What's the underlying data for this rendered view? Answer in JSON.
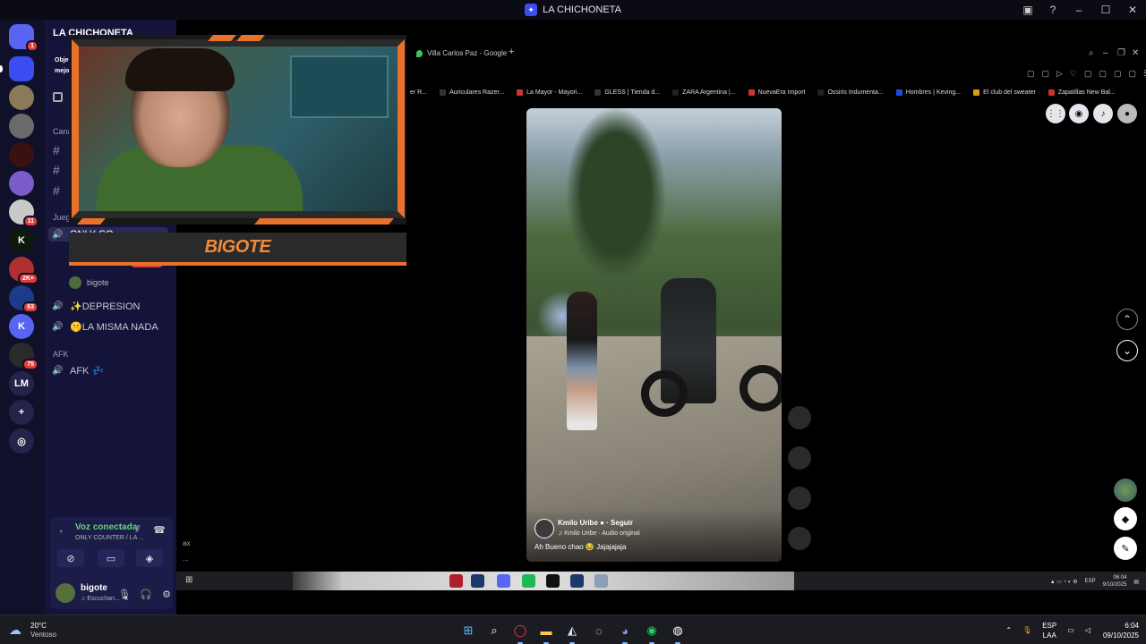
{
  "window": {
    "title": "LA CHICHONETA"
  },
  "server_rail": [
    {
      "name": "discord-home",
      "label": "",
      "badge": "1",
      "color": "#5865f2",
      "icon": "discord-icon"
    },
    {
      "name": "chichoneta",
      "label": "",
      "badge": "",
      "color": "#3b4df0",
      "icon": "runner-icon"
    },
    {
      "name": "server-3",
      "label": "",
      "badge": "",
      "color": "#8a7a5a",
      "icon": "avatar-icon"
    },
    {
      "name": "server-4",
      "label": "",
      "badge": "",
      "color": "#6a6a6a",
      "icon": "avatar-icon"
    },
    {
      "name": "server-5",
      "label": "",
      "badge": "",
      "color": "#3a1010",
      "icon": "avatar-icon"
    },
    {
      "name": "server-6",
      "label": "",
      "badge": "",
      "color": "#7b5cc8",
      "icon": "avatar-icon"
    },
    {
      "name": "server-7",
      "label": "",
      "badge": "11",
      "color": "#c9c9c9",
      "icon": "avatar-icon"
    },
    {
      "name": "server-kick",
      "label": "K",
      "badge": "",
      "color": "#0c1a0c",
      "icon": "kick-icon"
    },
    {
      "name": "server-9",
      "label": "",
      "badge": "2K+",
      "color": "#b03030",
      "icon": "avatar-icon"
    },
    {
      "name": "server-10",
      "label": "",
      "badge": "63",
      "color": "#1e3a8a",
      "icon": "avatar-icon"
    },
    {
      "name": "server-11",
      "label": "K",
      "badge": "",
      "color": "#5865f2",
      "icon": "k-icon"
    },
    {
      "name": "server-12",
      "label": "",
      "badge": "75",
      "color": "#2a2a2a",
      "icon": "avatar-icon"
    },
    {
      "name": "server-lm",
      "label": "LM",
      "badge": "",
      "color": "#24244a",
      "icon": ""
    },
    {
      "name": "add-server",
      "label": "+",
      "badge": "",
      "color": "#24244a",
      "icon": "plus-icon"
    },
    {
      "name": "discover",
      "label": "◎",
      "badge": "",
      "color": "#24244a",
      "icon": "compass-icon"
    }
  ],
  "sidebar": {
    "server_name": "LA CHICHONETA",
    "blurb": [
      "Obje",
      "mejo"
    ],
    "category_channels": "Cana",
    "category_games": "Jueg",
    "voice_channels": [
      {
        "label": "ONLY CO",
        "active": true
      },
      {
        "label": "✨DEPRESION",
        "active": false
      },
      {
        "label": "🤫LA MISMA NADA",
        "active": false
      }
    ],
    "users_in_channel": [
      {
        "name": "bigote"
      }
    ],
    "live_badge": "EN VIVO",
    "category_afk": "AFK",
    "afk_channel": "AFK 💤"
  },
  "voice_panel": {
    "title": "Voz conectada",
    "subtitle": "ONLY COUNTER / LA ...",
    "tools": [
      "camera-off-icon",
      "screen-share-icon",
      "activity-icon",
      "soundboard-icon"
    ],
    "user_name": "bigote",
    "user_status": "♫ Escuchan... +1"
  },
  "stream": {
    "tab_label": "Villa Carlos Paz - Google",
    "bookmarks": [
      "er R...",
      "Auriculares Razer...",
      "La Mayor - Mayori...",
      "GLESS | Tienda d...",
      "ZARA Argentina |...",
      "NuevaEra Import",
      "Ossiris Indumenta...",
      "Hombres | Keving...",
      "El club del sweater",
      "Zapatillas New Bal..."
    ],
    "video": {
      "author": "Kmilo Uribe ● · Seguir",
      "audio": "♫ Kmilo Uribe · Audio original",
      "caption": "Ah Bueno chao 😂 Jajajajaja"
    },
    "stray_a": "ax",
    "stray_b": "..."
  },
  "webcam": {
    "nameplate": "BIGOTE"
  },
  "inner_taskbar": {
    "lang": "ESP",
    "time": "06:04",
    "date": "9/10/2025"
  },
  "taskbar": {
    "weather_temp": "20°C",
    "weather_desc": "Ventoso",
    "lang_top": "ESP",
    "lang_bottom": "LAA",
    "time": "6:04",
    "date": "09/10/2025"
  }
}
